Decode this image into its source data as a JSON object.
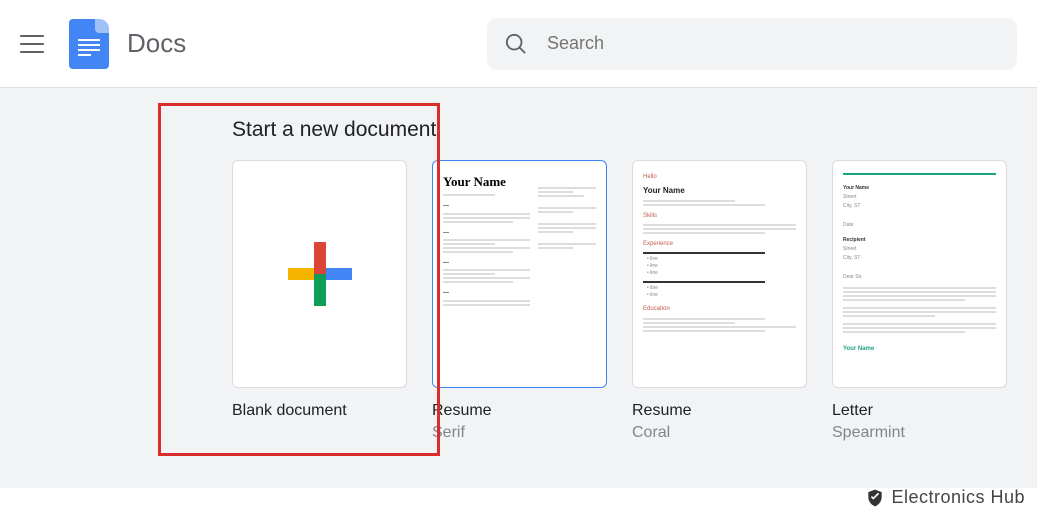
{
  "header": {
    "app_title": "Docs",
    "search_placeholder": "Search"
  },
  "section_title": "Start a new document",
  "templates": [
    {
      "title": "Blank document",
      "subtitle": ""
    },
    {
      "title": "Resume",
      "subtitle": "Serif"
    },
    {
      "title": "Resume",
      "subtitle": "Coral"
    },
    {
      "title": "Letter",
      "subtitle": "Spearmint"
    }
  ],
  "preview": {
    "serif_heading": "Your Name",
    "coral_name": "Your Name",
    "spearmint_sig": "Your Name"
  },
  "watermark": "Electronics Hub"
}
